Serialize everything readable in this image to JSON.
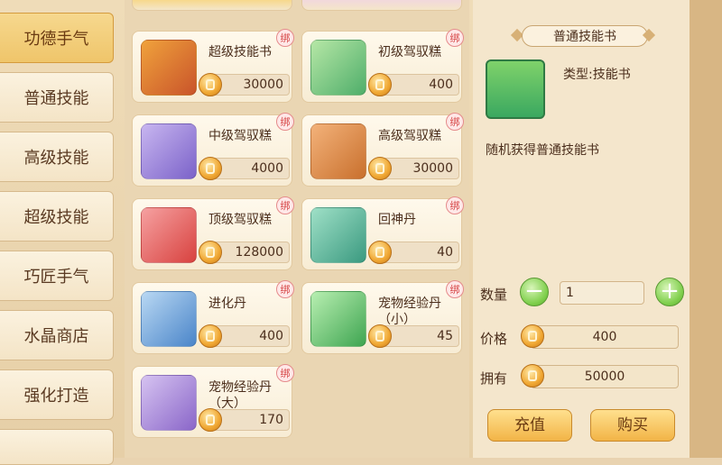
{
  "sidebar": {
    "items": [
      {
        "label": "功德手气",
        "active": true
      },
      {
        "label": "普通技能",
        "active": false
      },
      {
        "label": "高级技能",
        "active": false
      },
      {
        "label": "超级技能",
        "active": false
      },
      {
        "label": "巧匠手气",
        "active": false
      },
      {
        "label": "水晶商店",
        "active": false
      },
      {
        "label": "强化打造",
        "active": false
      }
    ]
  },
  "items": [
    {
      "name": "超级技能书",
      "price": "30000",
      "bound": "绑"
    },
    {
      "name": "初级驾驭糕",
      "price": "400",
      "bound": "绑"
    },
    {
      "name": "中级驾驭糕",
      "price": "4000",
      "bound": "绑"
    },
    {
      "name": "高级驾驭糕",
      "price": "30000",
      "bound": "绑"
    },
    {
      "name": "顶级驾驭糕",
      "price": "128000",
      "bound": "绑"
    },
    {
      "name": "回神丹",
      "price": "40",
      "bound": "绑"
    },
    {
      "name": "进化丹",
      "price": "400",
      "bound": "绑"
    },
    {
      "name": "宠物经验丹（小）",
      "price": "45",
      "bound": "绑"
    },
    {
      "name": "宠物经验丹（大）",
      "price": "170",
      "bound": "绑"
    }
  ],
  "detail": {
    "title": "普通技能书",
    "type_label": "类型:技能书",
    "description": "随机获得普通技能书",
    "quantity_label": "数量",
    "quantity": "1",
    "minus": "−",
    "plus": "+",
    "price_label": "价格",
    "price": "400",
    "own_label": "拥有",
    "own": "50000",
    "recharge_label": "充值",
    "buy_label": "购买"
  },
  "colors": {
    "accent": "#f2b447",
    "active_tab": "#efc56a",
    "plus_minus": "#7fcf4c"
  }
}
